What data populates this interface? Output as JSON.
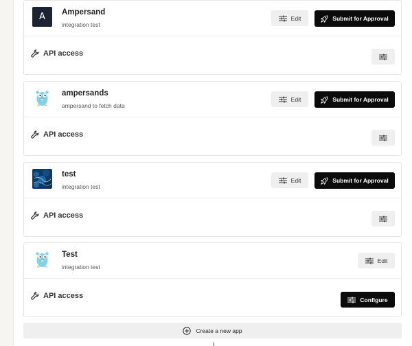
{
  "apps": [
    {
      "name": "Ampersand",
      "description": "integration test",
      "icon": "letter-a-logo-icon",
      "icon_letter": "A",
      "edit_label": "Edit",
      "submit_label": "Submit for Approval",
      "api_label": "API access",
      "api_action": "settings"
    },
    {
      "name": "ampersands",
      "description": "ampersand to fetch data",
      "icon": "gopher-mascot-icon",
      "edit_label": "Edit",
      "submit_label": "Submit for Approval",
      "api_label": "API access",
      "api_action": "settings"
    },
    {
      "name": "test",
      "description": "integration test",
      "icon": "blue-texture-image-icon",
      "edit_label": "Edit",
      "submit_label": "Submit for Approval",
      "api_label": "API access",
      "api_action": "settings"
    },
    {
      "name": "Test",
      "description": "integration test",
      "icon": "gopher-mascot-icon",
      "edit_label": "Edit",
      "api_label": "API access",
      "api_action": "configure",
      "configure_label": "Configure"
    }
  ],
  "create_app_label": "Create a new app",
  "colors": {
    "primary_button": "#0b0b0b",
    "secondary_button": "#efefef",
    "card_border": "#e6e6e6",
    "left_strip": "#f7f5f1"
  }
}
